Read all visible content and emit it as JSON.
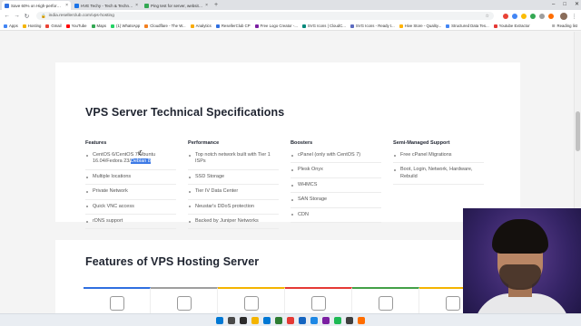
{
  "browser": {
    "tabs": [
      {
        "title": "Save 60% on High-performing Li...",
        "favicon_color": "#2f6fe0",
        "active": true
      },
      {
        "title": "HVE Techy - Tech & Technology...",
        "favicon_color": "#1a73e8",
        "active": false
      },
      {
        "title": "Ping test for server, website, ...",
        "favicon_color": "#34a853",
        "active": false
      }
    ],
    "new_tab": "+",
    "window_controls": [
      "–",
      "□",
      "✕"
    ],
    "url": "india.resellerclub.com/vps-hosting",
    "extension_colors": [
      "#e94235",
      "#4285f4",
      "#fbbc05",
      "#34a853",
      "#9e9e9e",
      "#ff6d00"
    ],
    "bookmarks": [
      {
        "label": "Apps",
        "color": "#4285f4"
      },
      {
        "label": "Hosting",
        "color": "#f4b400"
      },
      {
        "label": "Gmail",
        "color": "#ea4335"
      },
      {
        "label": "YouTube",
        "color": "#ff0000"
      },
      {
        "label": "Maps",
        "color": "#34a853"
      },
      {
        "label": "(1) WhatsApp",
        "color": "#25d366"
      },
      {
        "label": "Cloudflare - The W...",
        "color": "#f38020"
      },
      {
        "label": "Analytics",
        "color": "#f9ab00"
      },
      {
        "label": "ResellerClub CP",
        "color": "#2f6fe0"
      },
      {
        "label": "Free Logo Creator -...",
        "color": "#7b1fa2"
      },
      {
        "label": "SVG Icons | CloudC...",
        "color": "#00897b"
      },
      {
        "label": "SVG Icons - Ready t...",
        "color": "#5c6bc0"
      },
      {
        "label": "Hive Store - Quality...",
        "color": "#ffb300"
      },
      {
        "label": "Structured Data Tes...",
        "color": "#4285f4"
      },
      {
        "label": "Youtube Extractor",
        "color": "#e53935"
      }
    ],
    "reading_list": "Reading list"
  },
  "specs": {
    "title": "VPS Server Technical Specifications",
    "columns": [
      {
        "title": "Features",
        "items": [
          {
            "text": "CentOS 6/CentOS 7/Ubuntu 16.04/Fedora 23/",
            "highlight": "Debian 8"
          },
          {
            "text": "Multiple locations",
            "highlight": ""
          },
          {
            "text": "Private Network",
            "highlight": ""
          },
          {
            "text": "Quick VNC access",
            "highlight": ""
          },
          {
            "text": "rDNS support",
            "highlight": ""
          }
        ]
      },
      {
        "title": "Performance",
        "items": [
          {
            "text": "Top notch network built with Tier 1 ISPs",
            "highlight": ""
          },
          {
            "text": "SSD Storage",
            "highlight": ""
          },
          {
            "text": "Tier IV Data Center",
            "highlight": ""
          },
          {
            "text": "Neustar's DDoS protection",
            "highlight": ""
          },
          {
            "text": "Backed by Juniper Networks",
            "highlight": ""
          }
        ]
      },
      {
        "title": "Boosters",
        "items": [
          {
            "text": "cPanel (only with CentOS 7)",
            "highlight": ""
          },
          {
            "text": "Plesk Onyx",
            "highlight": ""
          },
          {
            "text": "WHMCS",
            "highlight": ""
          },
          {
            "text": "SAN Storage",
            "highlight": ""
          },
          {
            "text": "CDN",
            "highlight": ""
          }
        ]
      },
      {
        "title": "Semi-Managed Support",
        "items": [
          {
            "text": "Free cPanel Migrations",
            "highlight": ""
          },
          {
            "text": "Boot, Login, Network, Hardware, Rebuild",
            "highlight": ""
          }
        ]
      }
    ]
  },
  "features_section": {
    "title": "Features of VPS Hosting Server",
    "tab_accent_colors": [
      "#2f6fe0",
      "#9e9e9e",
      "#f4b400",
      "#e53935",
      "#43a047",
      "#f4b400"
    ]
  },
  "taskbar": {
    "icon_colors": [
      "#0078d4",
      "#4a4a4a",
      "#2b2b2b",
      "#f4b400",
      "#0078d4",
      "#2e7d32",
      "#e53935",
      "#1565c0",
      "#1e88e5",
      "#7b1fa2",
      "#1db954",
      "#3e3e3e",
      "#ff6d00"
    ]
  }
}
